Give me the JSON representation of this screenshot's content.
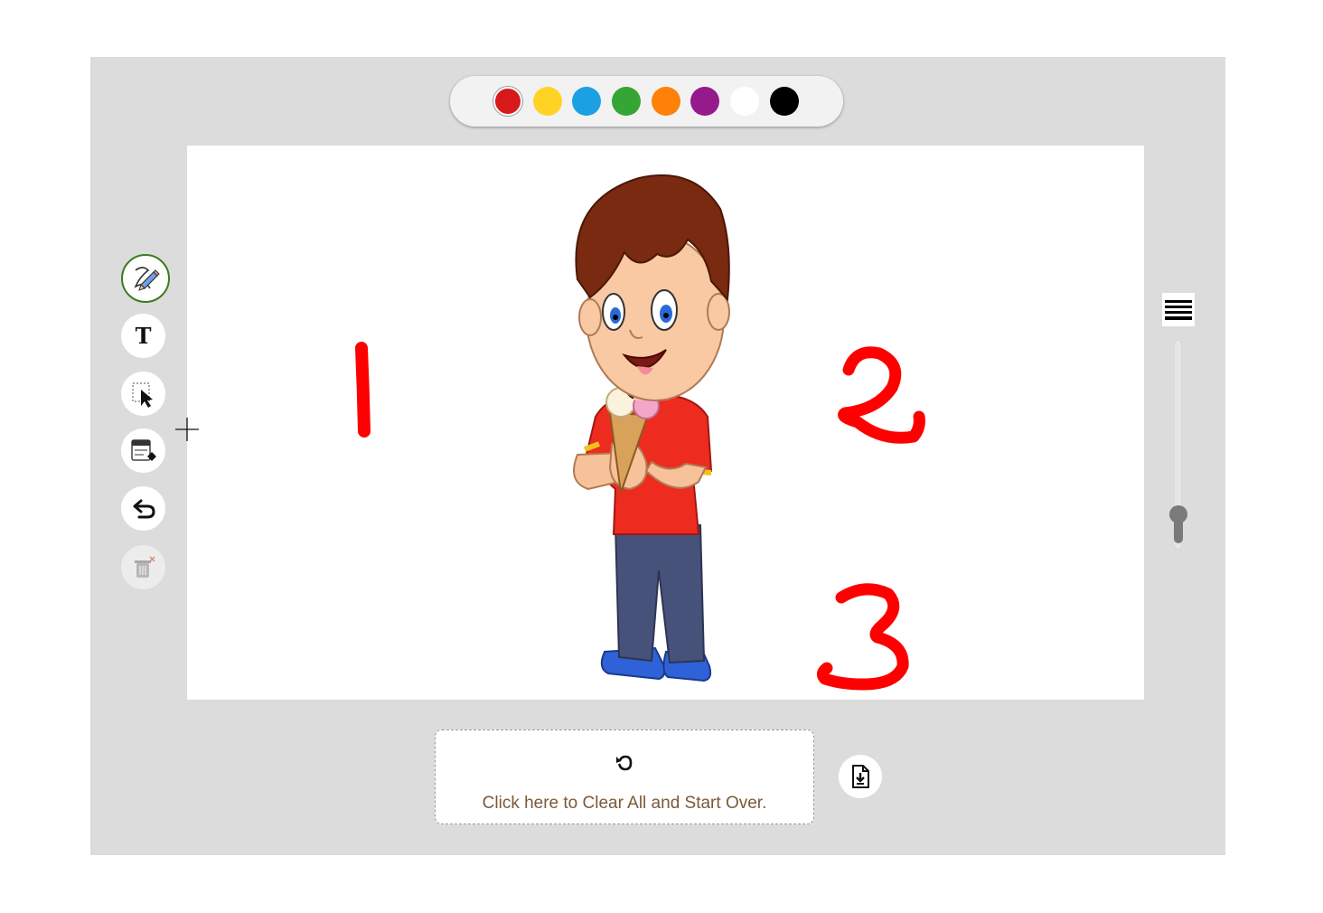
{
  "palette": {
    "colors": [
      {
        "name": "red",
        "hex": "#d7191c",
        "selected": true
      },
      {
        "name": "yellow",
        "hex": "#fed325"
      },
      {
        "name": "blue",
        "hex": "#1ba1e2"
      },
      {
        "name": "green",
        "hex": "#35a535"
      },
      {
        "name": "orange",
        "hex": "#ff8109"
      },
      {
        "name": "purple",
        "hex": "#951a8c"
      },
      {
        "name": "white",
        "hex": "#ffffff"
      },
      {
        "name": "black",
        "hex": "#000000"
      }
    ]
  },
  "tools": [
    {
      "name": "pencil-tool",
      "icon": "pencil-icon",
      "active": true
    },
    {
      "name": "text-tool",
      "icon": "text-t-icon",
      "glyph": "T"
    },
    {
      "name": "select-tool",
      "icon": "select-arrow-icon"
    },
    {
      "name": "eraser-tool",
      "icon": "eraser-icon"
    },
    {
      "name": "undo-tool",
      "icon": "undo-icon"
    },
    {
      "name": "delete-tool",
      "icon": "trash-icon",
      "disabled": true
    }
  ],
  "canvas": {
    "drawings": [
      "1",
      "2",
      "3"
    ],
    "image": "boy-with-ice-cream-illustration"
  },
  "brush": {
    "icon": "line-width-icon",
    "size_level": 0.12
  },
  "clear": {
    "icon": "refresh-icon",
    "label": "Click here to Clear All and Start Over."
  },
  "download": {
    "icon": "file-download-icon"
  },
  "colors": {
    "app_background": "#dcdcdc",
    "active_tool_border": "#3b7a1f",
    "ink": "#ff0000"
  }
}
